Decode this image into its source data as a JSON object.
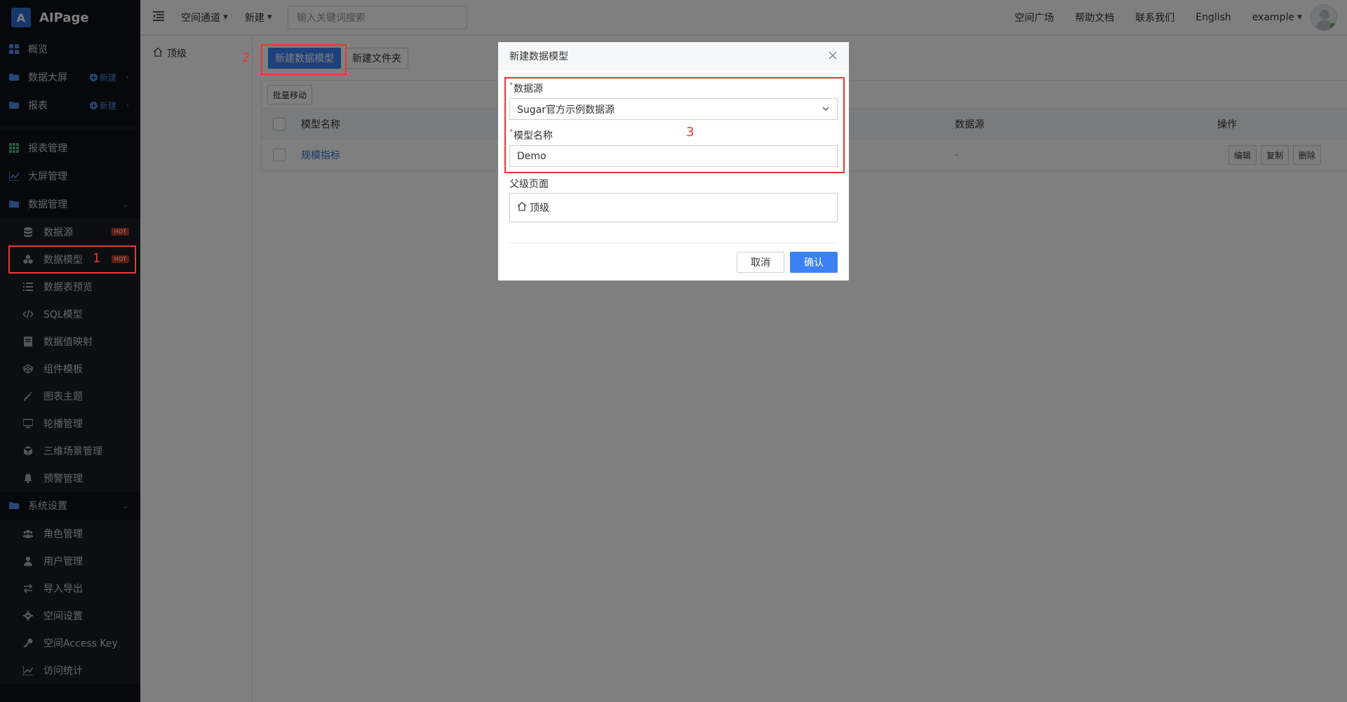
{
  "app": {
    "logo_letter": "A",
    "name": "AIPage"
  },
  "sidebar": {
    "top_items": [
      {
        "label": "概览"
      },
      {
        "label": "数据大屏",
        "new_label": "新建"
      },
      {
        "label": "报表",
        "new_label": "新建"
      }
    ],
    "manage_items": [
      {
        "label": "报表管理"
      },
      {
        "label": "大屏管理"
      },
      {
        "label": "数据管理"
      }
    ],
    "data_sub_items": [
      {
        "label": "数据源",
        "badge": "HOT"
      },
      {
        "label": "数据模型",
        "badge": "HOT"
      },
      {
        "label": "数据表预览"
      },
      {
        "label": "SQL模型"
      },
      {
        "label": "数据值映射"
      },
      {
        "label": "组件模板"
      },
      {
        "label": "图表主题"
      },
      {
        "label": "轮播管理"
      },
      {
        "label": "三维场景管理"
      },
      {
        "label": "预警管理"
      }
    ],
    "system_label": "系统设置",
    "system_sub_items": [
      {
        "label": "角色管理"
      },
      {
        "label": "用户管理"
      },
      {
        "label": "导入导出"
      },
      {
        "label": "空间设置"
      },
      {
        "label": "空间Access Key"
      },
      {
        "label": "访问统计"
      }
    ]
  },
  "topbar": {
    "space_channel": "空间通道",
    "new": "新建",
    "search_placeholder": "输入关键词搜索",
    "links": [
      "空间广场",
      "帮助文档",
      "联系我们",
      "English"
    ],
    "user": "example"
  },
  "tree": {
    "root": "顶级"
  },
  "main": {
    "new_model_btn": "新建数据模型",
    "new_folder_btn": "新建文件夹",
    "batch_move_btn": "批量移动",
    "columns": {
      "name": "模型名称",
      "datasource": "数据源",
      "ops": "操作"
    },
    "rows": [
      {
        "name": "规模指标",
        "datasource": "-",
        "ops": [
          "编辑",
          "复制",
          "删除"
        ]
      }
    ]
  },
  "modal": {
    "title": "新建数据模型",
    "datasource_label": "数据源",
    "datasource_value": "Sugar官方示例数据源",
    "model_name_label": "模型名称",
    "model_name_value": "Demo",
    "parent_label": "父级页面",
    "parent_value": "顶级",
    "cancel": "取消",
    "confirm": "确认"
  },
  "annotations": {
    "n1": "1",
    "n2": "2",
    "n3": "3"
  },
  "colors": {
    "primary": "#3b82f6",
    "annotation": "#e53935",
    "sidebar_bg": "#0e1116"
  }
}
